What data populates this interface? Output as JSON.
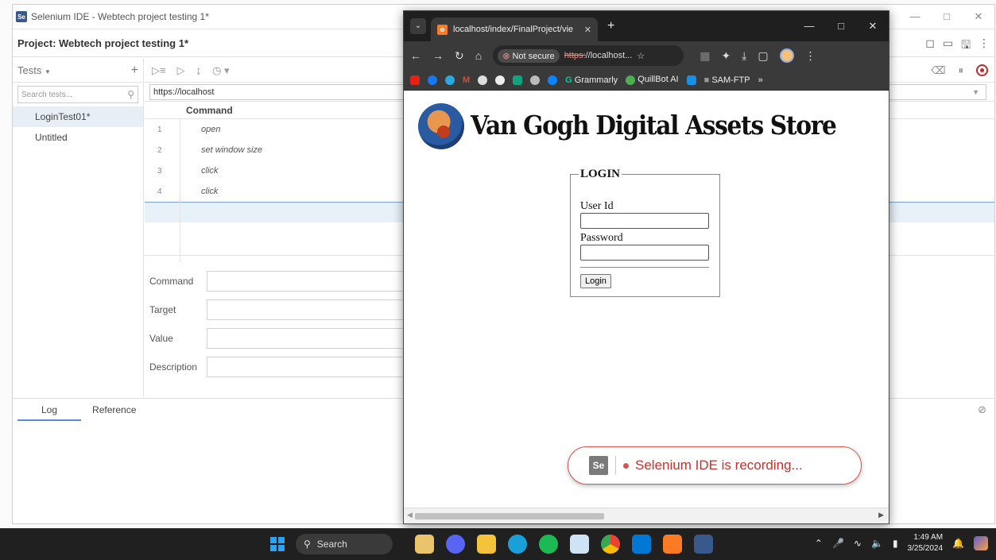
{
  "selenium": {
    "window_title": "Selenium IDE - Webtech project testing 1*",
    "project_label": "Project:  Webtech project testing 1*",
    "tests_header": "Tests",
    "add_test": "+",
    "search_placeholder": "Search tests...",
    "tests": [
      "LoginTest01*",
      "Untitled"
    ],
    "base_url": "https://localhost",
    "command_header": "Command",
    "commands": [
      {
        "num": "1",
        "cmd": "open"
      },
      {
        "num": "2",
        "cmd": "set window size"
      },
      {
        "num": "3",
        "cmd": "click"
      },
      {
        "num": "4",
        "cmd": "click"
      }
    ],
    "editor": {
      "command_label": "Command",
      "target_label": "Target",
      "value_label": "Value",
      "description_label": "Description"
    },
    "bottom_tabs": [
      "Log",
      "Reference"
    ]
  },
  "chrome": {
    "tab_title": "localhost/index/FinalProject/vie",
    "not_secure": "Not secure",
    "url_scheme": "https:",
    "url_rest": "//localhost...",
    "bookmarks": [
      "Grammarly",
      "QuillBot AI",
      "SAM-FTP"
    ],
    "more_bookmarks": "»"
  },
  "page": {
    "store_title": "Van Gogh Digital Assets Store",
    "login_legend": "LOGIN",
    "user_id_label": "User Id",
    "password_label": "Password",
    "login_button": "Login",
    "recording_text": "Selenium IDE is recording...",
    "se_badge": "Se"
  },
  "taskbar": {
    "search_label": "Search",
    "time": "1:49 AM",
    "date": "3/25/2024"
  },
  "colors": {
    "accent_blue": "#5b8dd6",
    "record_red": "#c62828",
    "chrome_dark": "#1f1f1f"
  }
}
